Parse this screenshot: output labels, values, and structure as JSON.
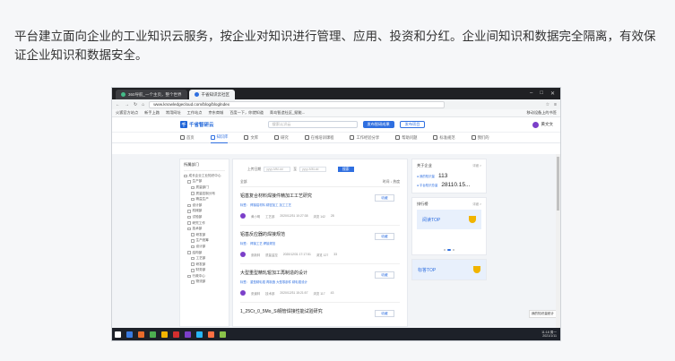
{
  "intro": {
    "paragraph": "平台建立面向企业的工业知识云服务，按企业对知识进行管理、应用、投资和分红。企业间知识和数据完全隔离，有效保证企业知识和数据安全。"
  },
  "browser": {
    "tabs": [
      {
        "label": "360导航_一个主页，整个世界"
      },
      {
        "label": "千省知识云社区"
      }
    ],
    "url": "www.knowledgecloud.com/blog/bloglndex",
    "bookmarks": [
      "火狐官方站点",
      "新手上路",
      "常用网址",
      "工作站点",
      "京东商城",
      "百度一下，你就知道",
      "青岛智造社区_赋能..."
    ],
    "bookmarks_right": "移动设备上的书签"
  },
  "app": {
    "logo_mark": "千",
    "logo_text": "千省智研云",
    "search_placeholder": "搜索认识云",
    "btn_publish": "发布智研成果",
    "btn_deal": "发布项目",
    "username": "黄文文",
    "nav": [
      "首页",
      "知识库",
      "文库",
      "研究",
      "在线培训课程",
      "工作经验分享",
      "帮助问题",
      "标准规范",
      "我们的"
    ]
  },
  "sidebar": {
    "title": "所属部门",
    "items": [
      "成长企业工业知识中心",
      "生产部",
      "质量部门",
      "质量控制分布",
      "精益生产",
      "设计部",
      "机械部",
      "试验部",
      "研究工作",
      "技术部",
      "研发部",
      "生产统筹",
      "设计部",
      "结构部",
      "工艺部",
      "研发部",
      "财务部",
      "行政中心",
      "物流部"
    ]
  },
  "main": {
    "filter_label": "上传日期",
    "date_start": "yyyy-MM-dd",
    "date_sep": "至",
    "date_end": "yyyy-MM-dd",
    "filter_btn": "搜索",
    "list_left": "全部",
    "list_right": "时间 ↓  热度",
    "articles": [
      {
        "title": "铝基复合材料焊接件精加工工艺研究",
        "tags": "标签： 焊接铝材料  精密加工  加工工艺",
        "author": "黄小明",
        "dept": "工艺部",
        "date": "2020/12/31 10:27:38",
        "views": "浏览 142",
        "likes": "28",
        "btn": "收藏"
      },
      {
        "title": "铝基反应器的焊接规范",
        "tags": "标签： 焊接工艺  焊接规范",
        "author": "张新林",
        "dept": "质量监控",
        "date": "2020/12/31 17:17:51",
        "views": "浏览 127",
        "likes": "33",
        "btn": "收藏"
      },
      {
        "title": "大型重型精轧辊加工再制造的设计",
        "tags": "标签： 重型精轧辊  再制造  大型零部件  精轧辊设计",
        "author": "张道林",
        "dept": "技术部",
        "date": "2020/12/31 15:21:57",
        "views": "浏览 117",
        "likes": "43",
        "btn": "收藏"
      },
      {
        "title": "1_25Cr_0_5Mo_Si钢管焊接性能试验研究",
        "tags": "",
        "author": "",
        "dept": "",
        "date": "",
        "views": "",
        "likes": "",
        "btn": "收藏"
      }
    ]
  },
  "right": {
    "card_title": "关于企业",
    "card_more": "详细 >",
    "stats": [
      {
        "label": "● 我的知识量",
        "value": "113"
      },
      {
        "label": "● 平台知识总量",
        "value": "28110.15..."
      }
    ],
    "rank_title": "排行榜",
    "rank_more": "详细 >",
    "banner_1": "阅读TOP",
    "banner_2": "标答TOP",
    "float_link": "我的知识量统计"
  },
  "taskbar": {
    "time": "11:18 周一",
    "date": "2021/1/11"
  },
  "colors": {
    "accent": "#2f6fe0",
    "avatar": "#7b3fc9",
    "trophy": "#f1b400"
  }
}
